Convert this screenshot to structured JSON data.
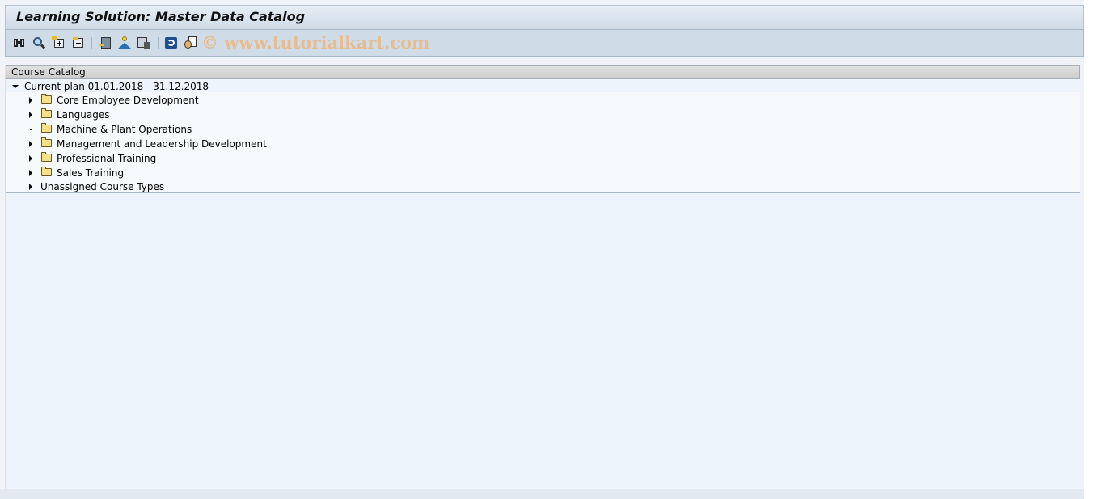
{
  "window": {
    "title": "Learning Solution: Master Data Catalog"
  },
  "toolbar": {
    "buttons": [
      {
        "icon": "binoculars-icon"
      },
      {
        "icon": "magnifier-icon"
      },
      {
        "icon": "expand-all-icon"
      },
      {
        "icon": "collapse-all-icon"
      },
      {
        "icon": "list-move-icon"
      },
      {
        "icon": "person-icon"
      },
      {
        "icon": "delete-list-icon"
      },
      {
        "icon": "refresh-icon"
      },
      {
        "icon": "info-person-icon"
      }
    ],
    "watermark": "© www.tutorialkart.com"
  },
  "panel": {
    "header": "Course Catalog",
    "root": {
      "label": "Current plan 01.01.2018 - 31.12.2018",
      "expanded": true
    },
    "items": [
      {
        "label": "Core Employee Development",
        "expander": "collapsed",
        "folder": true
      },
      {
        "label": "Languages",
        "expander": "collapsed",
        "folder": true
      },
      {
        "label": "Machine & Plant Operations",
        "expander": "leaf",
        "folder": true
      },
      {
        "label": "Management and Leadership Development",
        "expander": "collapsed",
        "folder": true
      },
      {
        "label": "Professional Training",
        "expander": "collapsed",
        "folder": true
      },
      {
        "label": "Sales Training",
        "expander": "collapsed",
        "folder": true
      },
      {
        "label": "Unassigned Course Types",
        "expander": "collapsed",
        "folder": false
      }
    ]
  }
}
